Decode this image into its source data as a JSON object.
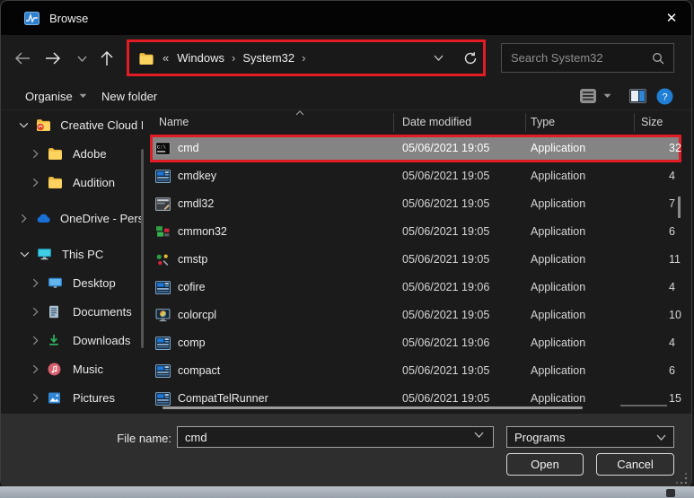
{
  "window": {
    "title": "Browse",
    "close_glyph": "✕"
  },
  "navbar": {
    "address": {
      "overflow_marker": "«",
      "crumbs": [
        "Windows",
        "System32"
      ],
      "separator": "›"
    },
    "search": {
      "placeholder": "Search System32"
    }
  },
  "toolbar": {
    "organise_label": "Organise",
    "new_folder_label": "New folder"
  },
  "sidebar": {
    "items": [
      {
        "label": "Creative Cloud F",
        "icon": "creative-cloud-folder",
        "expander": "expanded",
        "level": 0,
        "gap": false
      },
      {
        "label": "Adobe",
        "icon": "folder",
        "expander": "collapsed",
        "level": 1,
        "gap": false
      },
      {
        "label": "Audition",
        "icon": "folder",
        "expander": "collapsed",
        "level": 1,
        "gap": false
      },
      {
        "label": "OneDrive - Perso",
        "icon": "onedrive",
        "expander": "collapsed",
        "level": 0,
        "gap": true
      },
      {
        "label": "This PC",
        "icon": "this-pc",
        "expander": "expanded",
        "level": 0,
        "gap": true
      },
      {
        "label": "Desktop",
        "icon": "desktop",
        "expander": "collapsed",
        "level": 1,
        "gap": false
      },
      {
        "label": "Documents",
        "icon": "documents",
        "expander": "collapsed",
        "level": 1,
        "gap": false
      },
      {
        "label": "Downloads",
        "icon": "downloads",
        "expander": "collapsed",
        "level": 1,
        "gap": false
      },
      {
        "label": "Music",
        "icon": "music",
        "expander": "collapsed",
        "level": 1,
        "gap": false
      },
      {
        "label": "Pictures",
        "icon": "pictures",
        "expander": "collapsed",
        "level": 1,
        "gap": false
      }
    ]
  },
  "list": {
    "columns": {
      "name": "Name",
      "date": "Date modified",
      "type": "Type",
      "size": "Size"
    },
    "rows": [
      {
        "name": "cmd",
        "date": "05/06/2021 19:05",
        "type": "Application",
        "size": "32",
        "icon": "cmd",
        "selected": true
      },
      {
        "name": "cmdkey",
        "date": "05/06/2021 19:05",
        "type": "Application",
        "size": "4",
        "icon": "app",
        "selected": false
      },
      {
        "name": "cmdl32",
        "date": "05/06/2021 19:05",
        "type": "Application",
        "size": "7",
        "icon": "cmdl32",
        "selected": false
      },
      {
        "name": "cmmon32",
        "date": "05/06/2021 19:05",
        "type": "Application",
        "size": "6",
        "icon": "cmmon32",
        "selected": false
      },
      {
        "name": "cmstp",
        "date": "05/06/2021 19:05",
        "type": "Application",
        "size": "11",
        "icon": "cmstp",
        "selected": false
      },
      {
        "name": "cofire",
        "date": "05/06/2021 19:06",
        "type": "Application",
        "size": "4",
        "icon": "app",
        "selected": false
      },
      {
        "name": "colorcpl",
        "date": "05/06/2021 19:05",
        "type": "Application",
        "size": "10",
        "icon": "colorcpl",
        "selected": false
      },
      {
        "name": "comp",
        "date": "05/06/2021 19:06",
        "type": "Application",
        "size": "4",
        "icon": "app",
        "selected": false
      },
      {
        "name": "compact",
        "date": "05/06/2021 19:05",
        "type": "Application",
        "size": "6",
        "icon": "app",
        "selected": false
      },
      {
        "name": "CompatTelRunner",
        "date": "05/06/2021 19:05",
        "type": "Application",
        "size": "15",
        "icon": "app",
        "selected": false
      }
    ]
  },
  "footer": {
    "file_name_label": "File name:",
    "file_name_value": "cmd",
    "file_type_value": "Programs",
    "open_label": "Open",
    "cancel_label": "Cancel"
  },
  "colors": {
    "highlight_red": "#e11c24",
    "selection_gray": "#848484",
    "accent_blue": "#1f7fd4"
  }
}
